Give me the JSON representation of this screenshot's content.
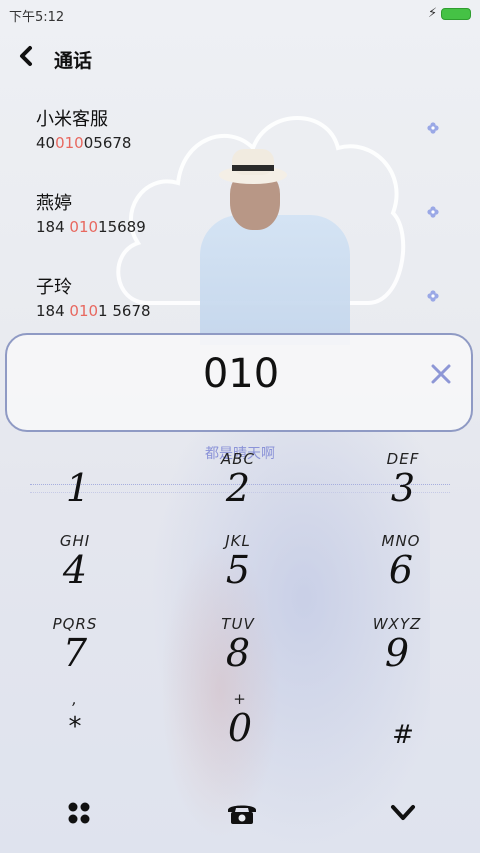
{
  "status_bar": {
    "time": "下午5:12",
    "charging_icon": "lightning-icon",
    "battery_color": "#45c245"
  },
  "header": {
    "back_icon": "chevron-left-icon",
    "title": "通话"
  },
  "results": [
    {
      "name": "小米客服",
      "number_parts": [
        "40",
        "010",
        "05678"
      ],
      "highlight_index": 1
    },
    {
      "name": "燕婷",
      "number_parts": [
        "184 ",
        "010",
        "15689"
      ],
      "highlight_index": 1
    },
    {
      "name": "子玲",
      "number_parts": [
        "184 ",
        "010",
        "1 5678"
      ],
      "highlight_index": 1
    }
  ],
  "entry": {
    "value": "010",
    "clear_icon": "close-icon"
  },
  "location": "都是晴天啊",
  "keypad": [
    {
      "digit": "1",
      "letters": ""
    },
    {
      "digit": "2",
      "letters": "ABC"
    },
    {
      "digit": "3",
      "letters": "DEF"
    },
    {
      "digit": "4",
      "letters": "GHI"
    },
    {
      "digit": "5",
      "letters": "JKL"
    },
    {
      "digit": "6",
      "letters": "MNO"
    },
    {
      "digit": "7",
      "letters": "PQRS"
    },
    {
      "digit": "8",
      "letters": "TUV"
    },
    {
      "digit": "9",
      "letters": "WXYZ"
    },
    {
      "digit": "*",
      "letters": ","
    },
    {
      "digit": "0",
      "letters": "+"
    },
    {
      "digit": "#",
      "letters": ""
    }
  ],
  "bottom_bar": {
    "left_icon": "grid-dots-icon",
    "center_icon": "phone-icon",
    "right_icon": "chevron-down-icon"
  },
  "colors": {
    "accent": "#8b93d8",
    "highlight": "#e8685f",
    "entry_border": "#8f9ac4"
  }
}
